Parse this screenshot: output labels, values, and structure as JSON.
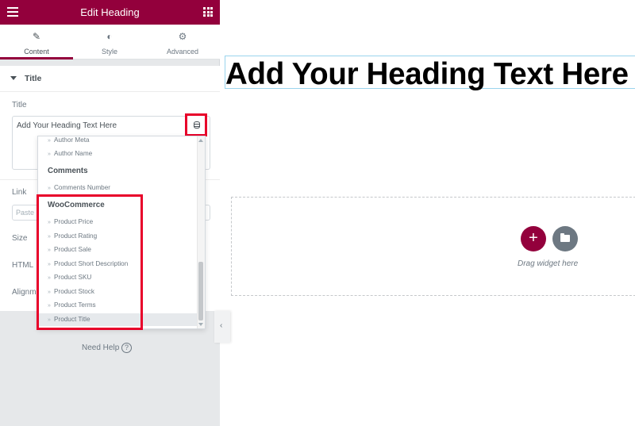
{
  "header": {
    "title": "Edit Heading"
  },
  "tabs": [
    {
      "label": "Content",
      "icon": "pencil-icon",
      "active": true
    },
    {
      "label": "Style",
      "icon": "contrast-icon",
      "active": false
    },
    {
      "label": "Advanced",
      "icon": "gear-icon",
      "active": false
    }
  ],
  "section": {
    "title": "Title"
  },
  "fields": {
    "title_label": "Title",
    "title_value": "Add Your Heading Text Here",
    "link_label": "Link",
    "link_placeholder": "Paste",
    "size_label": "Size",
    "html_tag_label": "HTML",
    "alignment_label": "Alignm"
  },
  "dropdown": {
    "items_top": [
      "Author Meta",
      "Author Name"
    ],
    "group_comments": "Comments",
    "comments_items": [
      "Comments Number"
    ],
    "group_woo": "WooCommerce",
    "woo_items": [
      "Product Price",
      "Product Rating",
      "Product Sale",
      "Product Short Description",
      "Product SKU",
      "Product Stock",
      "Product Terms",
      "Product Title"
    ],
    "chevron": "»"
  },
  "footer": {
    "help_label": "Need Help",
    "help_icon_glyph": "?"
  },
  "canvas": {
    "heading_text": "Add Your Heading Text Here",
    "add_glyph": "+",
    "drag_text": "Drag widget here"
  },
  "colors": {
    "brand": "#93003c",
    "highlight": "#e8002a",
    "muted": "#6d7882"
  }
}
